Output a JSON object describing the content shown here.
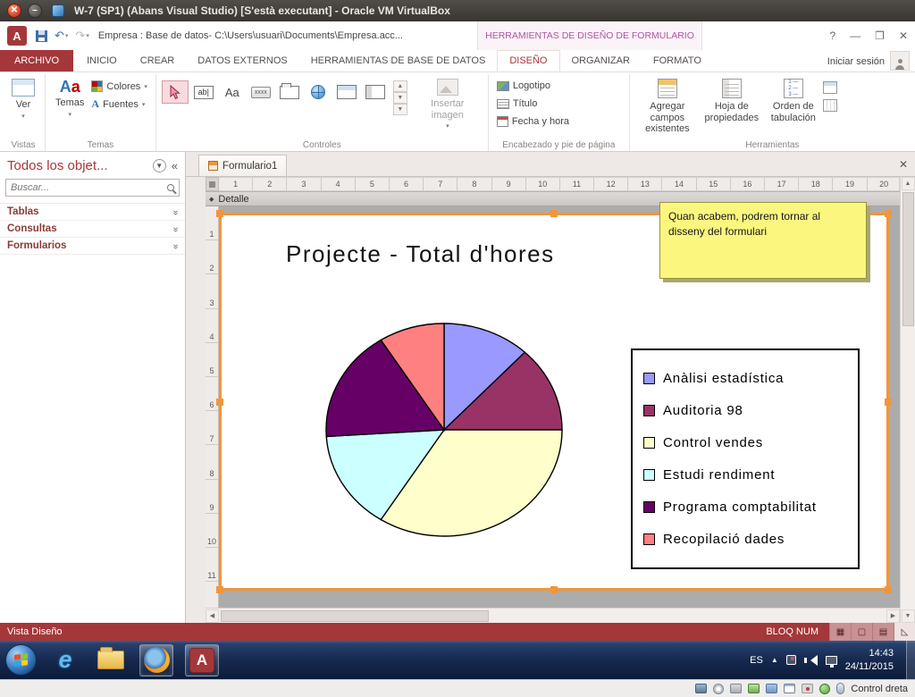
{
  "vbox": {
    "title": "W-7 (SP1) (Abans Visual Studio) [S'està executant] - Oracle VM VirtualBox",
    "host_key": "Control dreta"
  },
  "app": {
    "quick_title": "Empresa : Base de datos- C:\\Users\\usuari\\Documents\\Empresa.acc...",
    "contextual_header": "HERRAMIENTAS DE DISEÑO DE FORMULARIO",
    "sign_in": "Iniciar sesión"
  },
  "ribbon": {
    "tabs": [
      {
        "label": "ARCHIVO",
        "file": true
      },
      {
        "label": "INICIO"
      },
      {
        "label": "CREAR"
      },
      {
        "label": "DATOS EXTERNOS"
      },
      {
        "label": "HERRAMIENTAS DE BASE DE DATOS"
      },
      {
        "label": "DISEÑO",
        "active": true
      },
      {
        "label": "ORGANIZAR"
      },
      {
        "label": "FORMATO"
      }
    ],
    "vistas": {
      "group": "Vistas",
      "ver": "Ver"
    },
    "temas": {
      "group": "Temas",
      "temas": "Temas",
      "colores": "Colores",
      "fuentes": "Fuentes"
    },
    "controles": {
      "group": "Controles",
      "insertar_imagen": "Insertar imagen"
    },
    "encabezado": {
      "group": "Encabezado y pie de página",
      "logotipo": "Logotipo",
      "titulo": "Título",
      "fecha_hora": "Fecha y hora"
    },
    "herramientas": {
      "group": "Herramientas",
      "agregar": "Agregar campos existentes",
      "hoja": "Hoja de propiedades",
      "orden": "Orden de tabulación"
    }
  },
  "nav": {
    "title": "Todos los objet...",
    "search_placeholder": "Buscar...",
    "sections": [
      "Tablas",
      "Consultas",
      "Formularios"
    ]
  },
  "doc": {
    "tab": "Formulario1",
    "section": "Detalle",
    "note": "Quan acabem, podrem tornar al disseny del formulari"
  },
  "rulers": {
    "horizontal": [
      1,
      2,
      3,
      4,
      5,
      6,
      7,
      8,
      9,
      10,
      11,
      12,
      13,
      14,
      15,
      16,
      17,
      18,
      19,
      20
    ],
    "vertical": [
      1,
      2,
      3,
      4,
      5,
      6,
      7,
      8,
      9,
      10,
      11
    ]
  },
  "chart_data": {
    "type": "pie",
    "title": "Projecte - Total d'hores",
    "legend_position": "right",
    "slices": [
      {
        "label": "Anàlisi estadística",
        "value": 12,
        "color": "#9999FF"
      },
      {
        "label": "Auditoria 98",
        "value": 13,
        "color": "#993366"
      },
      {
        "label": "Control vendes",
        "value": 34,
        "color": "#FFFFCC"
      },
      {
        "label": "Estudi rendiment",
        "value": 15,
        "color": "#CCFFFF"
      },
      {
        "label": "Programa comptabilitat",
        "value": 17,
        "color": "#660066"
      },
      {
        "label": "Recopilació dades",
        "value": 9,
        "color": "#FF8080"
      }
    ]
  },
  "status": {
    "left": "Vista Diseño",
    "numlock": "BLOQ NUM"
  },
  "taskbar": {
    "language": "ES",
    "time": "14:43",
    "date": "24/11/2015"
  }
}
